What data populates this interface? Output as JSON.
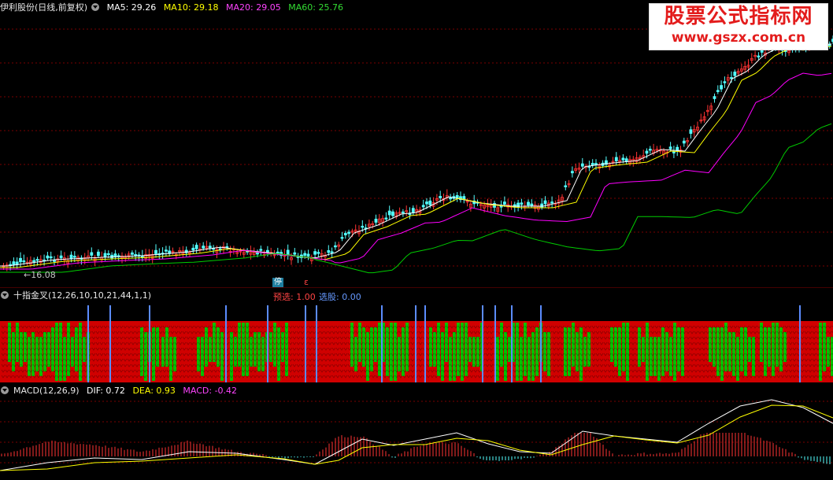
{
  "main_chart": {
    "stock_label": "伊利股份(日线,前复权)",
    "ma5": "MA5: 29.26",
    "ma10": "MA10: 29.18",
    "ma20": "MA20: 29.05",
    "ma60": "MA60: 25.76",
    "low_marker": "←16.08",
    "colors": {
      "ma5": "#ffffff",
      "ma10": "#ffff00",
      "ma20": "#ff00ff",
      "ma60": "#00cc00",
      "up": "#ff3333",
      "down": "#54ffff"
    }
  },
  "signal_panel": {
    "badge_stop": "停",
    "badge_small": "ε",
    "indicator_label": "十指金叉(12,26,10,10,21,44,1,1)",
    "preselect": "预选: 1.00",
    "selected": "选股: 0.00",
    "colors": {
      "bull": "#e00000",
      "bear": "#00c000",
      "marker": "#5b8cff"
    }
  },
  "macd": {
    "label": "MACD(12,26,9)",
    "dif": "DIF: 0.72",
    "dea": "DEA: 0.93",
    "macd": "MACD: -0.42"
  },
  "watermark": {
    "line1": "股票公式指标网",
    "line2": "www.gszx.com.cn"
  }
}
